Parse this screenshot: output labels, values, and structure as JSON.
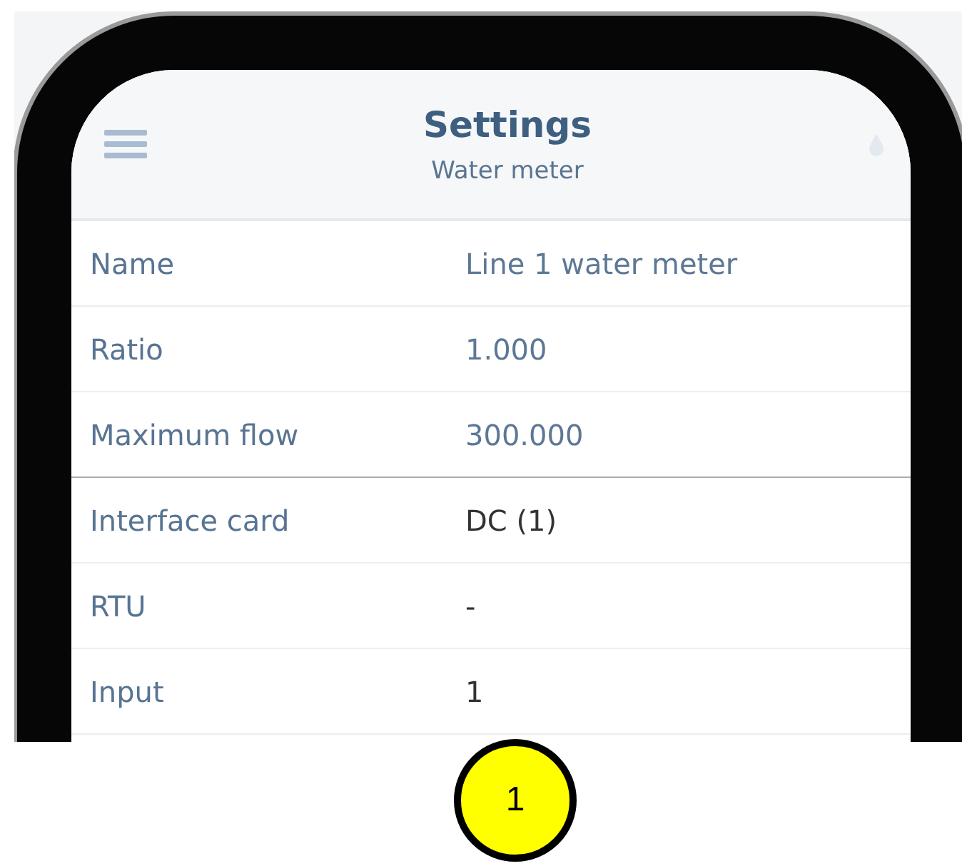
{
  "header": {
    "title": "Settings",
    "subtitle": "Water meter"
  },
  "rows": [
    {
      "label": "Name",
      "value": "Line 1 water meter",
      "kind": "editable"
    },
    {
      "label": "Ratio",
      "value": "1.000",
      "kind": "editable"
    },
    {
      "label": "Maximum flow",
      "value": "300.000",
      "kind": "editable"
    },
    {
      "label": "Interface card",
      "value": "DC (1)",
      "kind": "readonly"
    },
    {
      "label": "RTU",
      "value": "-",
      "kind": "readonly"
    },
    {
      "label": "Input",
      "value": "1",
      "kind": "readonly"
    }
  ],
  "callout": {
    "label": "1"
  }
}
